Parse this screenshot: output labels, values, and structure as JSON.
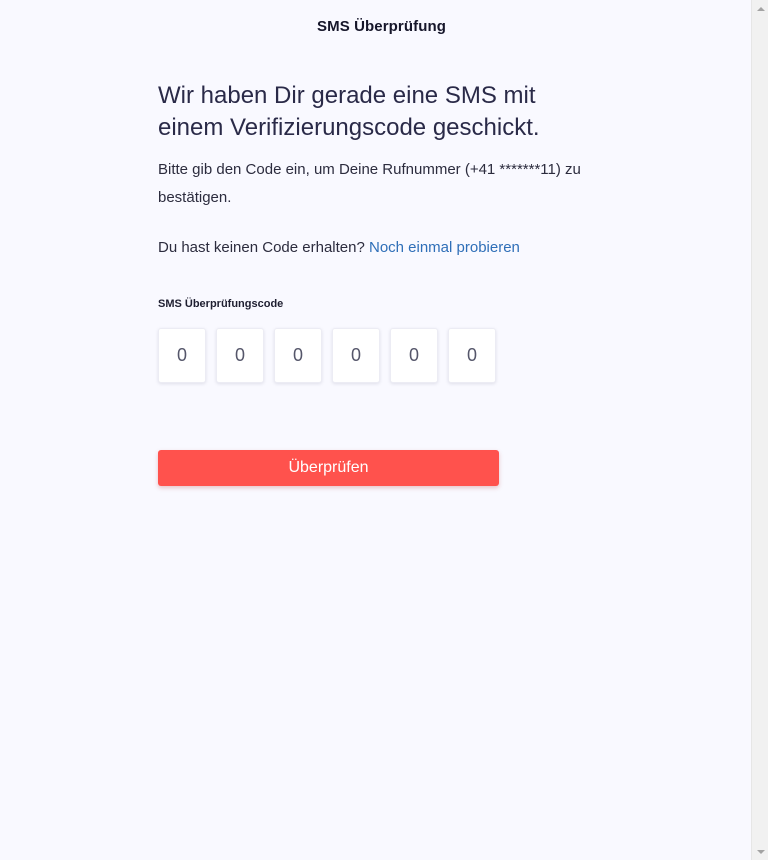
{
  "header": {
    "title": "SMS Überprüfung"
  },
  "main": {
    "headline": "Wir haben Dir gerade eine SMS mit einem Verifizierungscode geschickt.",
    "description": "Bitte gib den Code ein, um Deine Rufnummer (+41 *******11) zu bestätigen.",
    "retry_prompt": "Du hast keinen Code erhalten?",
    "retry_link": "Noch einmal probieren",
    "code_label": "SMS Überprüfungscode",
    "code_digits": [
      {
        "placeholder": "0",
        "value": ""
      },
      {
        "placeholder": "0",
        "value": ""
      },
      {
        "placeholder": "0",
        "value": ""
      },
      {
        "placeholder": "0",
        "value": ""
      },
      {
        "placeholder": "0",
        "value": ""
      },
      {
        "placeholder": "0",
        "value": ""
      }
    ],
    "submit_label": "Überprüfen"
  },
  "icons": {
    "scroll_up": "scroll-up-arrow-icon",
    "scroll_down": "scroll-down-arrow-icon"
  },
  "colors": {
    "background": "#f9f9ff",
    "accent": "#ff524d",
    "link": "#2f6fb8",
    "text": "#2a2a48"
  }
}
